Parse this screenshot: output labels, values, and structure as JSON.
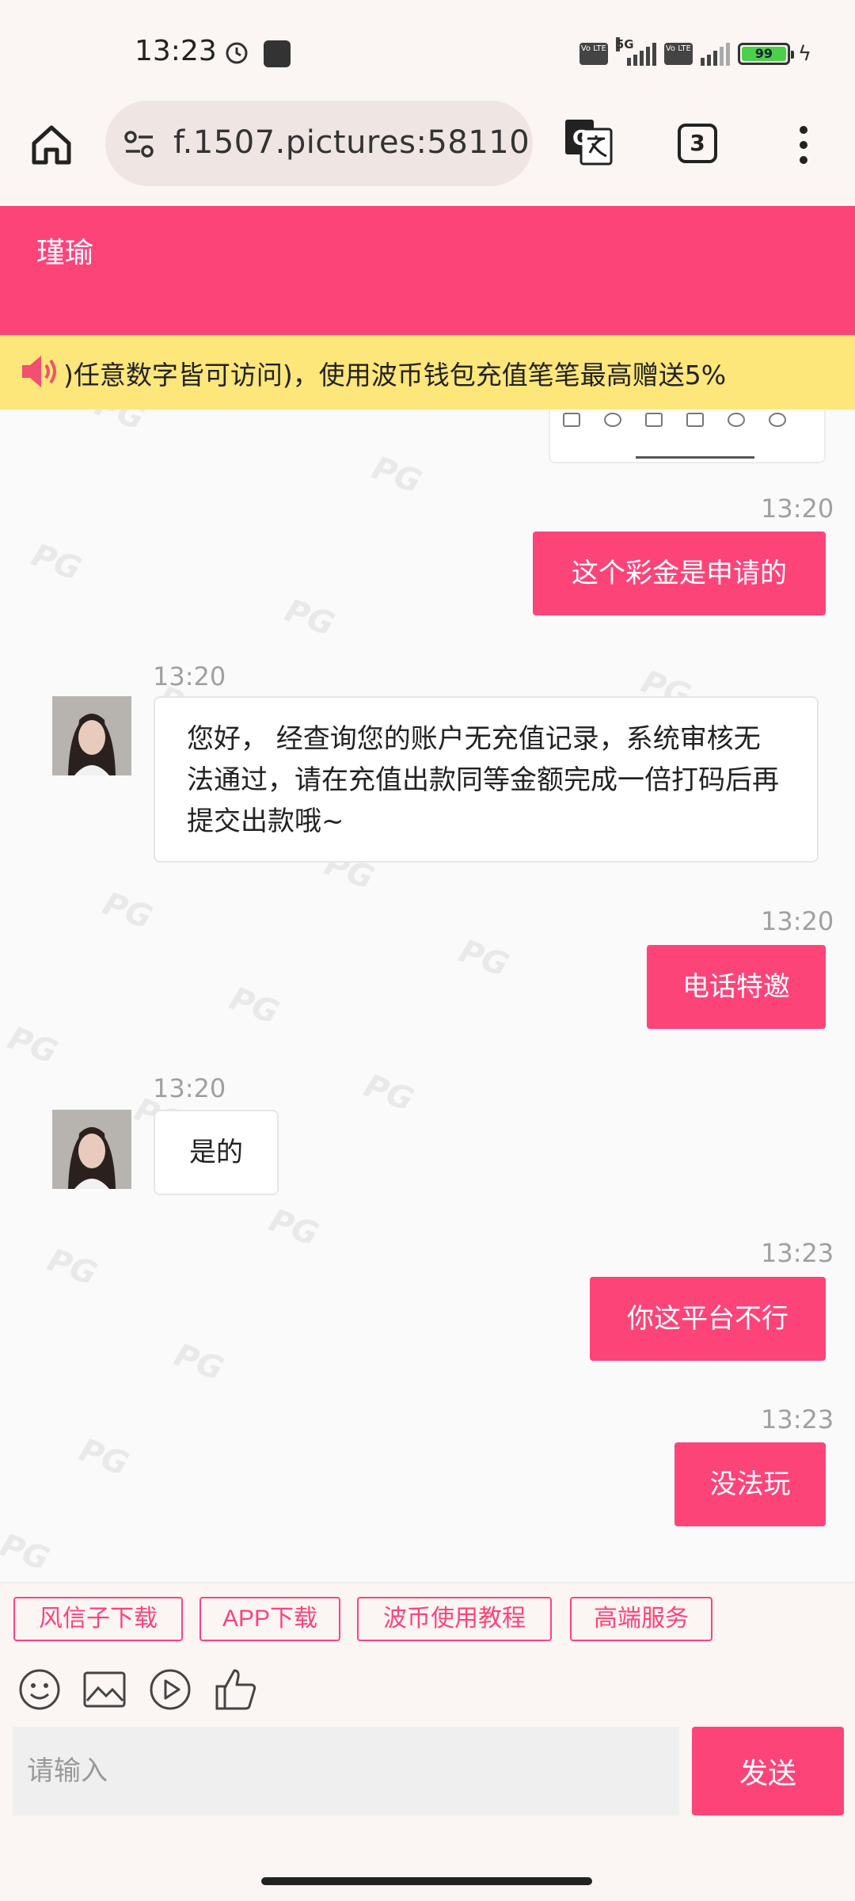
{
  "status_bar": {
    "time": "13:23",
    "volte_label": "Vo LTE",
    "network_label": "5G",
    "battery_level": "99"
  },
  "browser": {
    "url": "f.1507.pictures:58110",
    "tab_count": "3"
  },
  "chat": {
    "title": "瑾瑜",
    "notice": ")任意数字皆可访问)，使用波币钱包充值笔笔最高赠送5%",
    "watermark_text": "PG",
    "messages": [
      {
        "side": "out",
        "time": "13:20",
        "text": "这个彩金是申请的"
      },
      {
        "side": "in",
        "time": "13:20",
        "text": "您好， 经查询您的账户无充值记录，系统审核无法通过，请在充值出款同等金额完成一倍打码后再提交出款哦~"
      },
      {
        "side": "out",
        "time": "13:20",
        "text": "电话特邀"
      },
      {
        "side": "in",
        "time": "13:20",
        "text": "是的"
      },
      {
        "side": "out",
        "time": "13:23",
        "text": "你这平台不行"
      },
      {
        "side": "out",
        "time": "13:23",
        "text": "没法玩"
      }
    ]
  },
  "quick_links": [
    "风信子下载",
    "APP下载",
    "波币使用教程",
    "高端服务"
  ],
  "tools": [
    "emoji-icon",
    "image-icon",
    "video-icon",
    "thumbs-up-icon"
  ],
  "input": {
    "placeholder": "请输入",
    "send_label": "发送"
  },
  "colors": {
    "accent": "#fd4479",
    "notice_bg": "#fde67a"
  }
}
